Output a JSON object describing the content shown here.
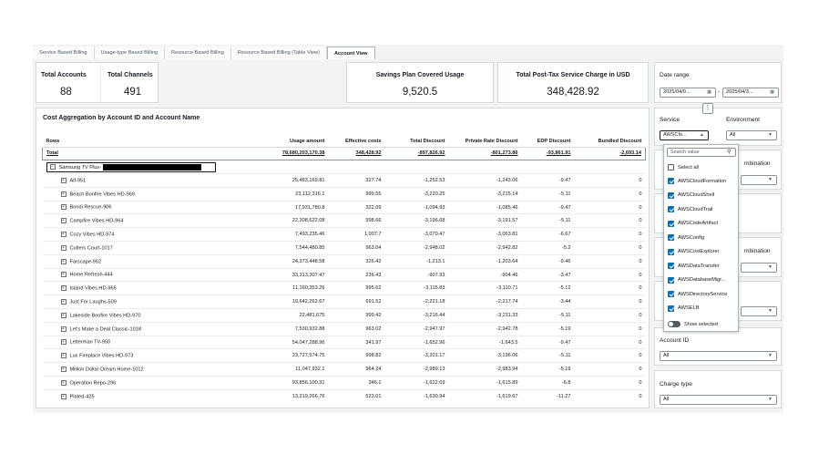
{
  "tabs": [
    {
      "label": "Service Based Billing"
    },
    {
      "label": "Usage-type Based Billing"
    },
    {
      "label": "Resource Based Billing"
    },
    {
      "label": "Resource Based Billing (Table View)"
    },
    {
      "label": "Account View",
      "active": true
    }
  ],
  "kpis": {
    "total_accounts": {
      "label": "Total Accounts",
      "value": "88"
    },
    "total_channels": {
      "label": "Total Channels",
      "value": "491"
    },
    "savings_plan": {
      "label": "Savings Plan Covered Usage",
      "value": "9,520.5"
    },
    "post_tax": {
      "label": "Total Post-Tax Service Charge in USD",
      "value": "348,428.92"
    }
  },
  "date_range": {
    "label": "Date range",
    "from": "2025/04/0...",
    "separator": "-",
    "to": "2025/04/3..."
  },
  "table": {
    "title": "Cost Aggregation by Account ID and Account Name",
    "columns": [
      "Rows",
      "Usage amount",
      "Effective costs",
      "Total Discount",
      "Private Rate Discount",
      "EDP Discount",
      "Bundled Discount"
    ],
    "total": [
      "Total",
      "78,680,203,170.38",
      "348,428.92",
      "-897,826.92",
      "-801,273.86",
      "-93,861.91",
      "-2,693.14"
    ],
    "group": "Samsung TV Plus-",
    "rows": [
      [
        "Alf-951",
        "25,483,169.81",
        "327.74",
        "-1,252.53",
        "-1,243.06",
        "-9.47",
        "0"
      ],
      [
        "Beach Bonfire Vibes HD-969",
        "23,112,316.1",
        "999.55",
        "-3,220.25",
        "-3,215.14",
        "-5.11",
        "0"
      ],
      [
        "Bondi Rescue-906",
        "17,931,780.8",
        "322.09",
        "-1,094.93",
        "-1,085.46",
        "-9.47",
        "0"
      ],
      [
        "Campfire Vibes HD-964",
        "22,308,622.08",
        "998.66",
        "-3,196.68",
        "-3,191.57",
        "-5.11",
        "0"
      ],
      [
        "Cozy Vibes HD-974",
        "7,493,235.46",
        "1,007.7",
        "-3,070.47",
        "-3,063.81",
        "-6.67",
        "0"
      ],
      [
        "Cutlers Court-1017",
        "7,544,480.85",
        "963.04",
        "-2,948.02",
        "-2,942.82",
        "-5.2",
        "0"
      ],
      [
        "Farscape-952",
        "24,373,448.58",
        "326.42",
        "-1,213.1",
        "-1,203.64",
        "-9.46",
        "0"
      ],
      [
        "Home Refresh-444",
        "33,313,307.47",
        "236.43",
        "-907.93",
        "-904.46",
        "-3.47",
        "0"
      ],
      [
        "Island Vibes HD-965",
        "11,160,353.26",
        "995.62",
        "-3,115.83",
        "-3,110.71",
        "-5.12",
        "0"
      ],
      [
        "Just For Laughs-509",
        "19,642,262.67",
        "691.52",
        "-2,221.18",
        "-2,217.74",
        "-3.44",
        "0"
      ],
      [
        "Lakeside Bonfire Vibes HD-970",
        "22,481,675",
        "999.42",
        "-3,216.44",
        "-3,211.33",
        "-5.11",
        "0"
      ],
      [
        "Let's Make a Deal Classic-1018",
        "7,530,932.88",
        "963.02",
        "-2,947.97",
        "-2,942.78",
        "-5.19",
        "0"
      ],
      [
        "Letterman TV-950",
        "54,047,288.96",
        "341.97",
        "-1,652.96",
        "-1,643.5",
        "-9.47",
        "0"
      ],
      [
        "Lux Fireplace Vibes HD-973",
        "23,727,574.75",
        "998.82",
        "-3,201.17",
        "-3,196.06",
        "-5.11",
        "0"
      ],
      [
        "Million Dollar Dream Home-1012",
        "11,047,932.1",
        "964.24",
        "-2,989.13",
        "-2,983.94",
        "-5.19",
        "0"
      ],
      [
        "Operation Repo-296",
        "93,856,100.31",
        "346.1",
        "-1,622.69",
        "-1,615.89",
        "-6.8",
        "0"
      ],
      [
        "Plated-425",
        "13,219,266.76",
        "523.01",
        "-1,630.94",
        "-1,619.67",
        "-11.27",
        "0"
      ]
    ]
  },
  "filters": {
    "service": {
      "label": "Service",
      "value": "AWSClo..."
    },
    "environment": {
      "label": "Environment",
      "value": "All"
    },
    "combination_1": {
      "label": "mbination"
    },
    "combination_2": {
      "label": "mbination"
    },
    "account_id": {
      "label": "Account ID",
      "value": "All"
    },
    "charge_type": {
      "label": "Charge type",
      "value": "All"
    }
  },
  "service_dropdown": {
    "search_placeholder": "Search value",
    "select_all": "Select all",
    "options": [
      "AWSCloudFormation",
      "AWSCloudShell",
      "AWSCloudTrail",
      "AWSCodeArtifact",
      "AWSConfig",
      "AWSCostExplorer",
      "AWSDataTransfer",
      "AWSDatabaseMigr...",
      "AWSDirectoryService",
      "AWSELB"
    ],
    "show_selected": "Show selected"
  },
  "colors": {
    "accent": "#0073bb",
    "border": "#d5dbdb",
    "background": "#f2f3f3"
  }
}
